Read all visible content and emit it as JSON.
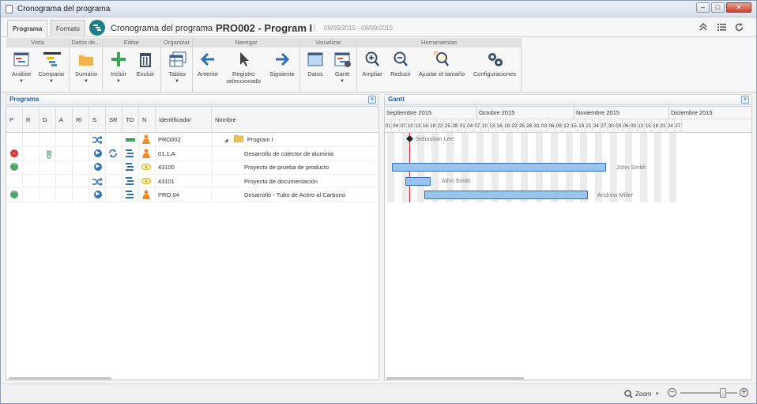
{
  "window": {
    "title": "Cronograma del programa"
  },
  "tabs": [
    {
      "label": "Programa",
      "active": true
    },
    {
      "label": "Formato",
      "active": false
    }
  ],
  "breadcrumb": {
    "section": "Cronograma del programa",
    "separator": "›",
    "record": "PRO002 - Program I",
    "divider": "|",
    "dates": "09/09/2015 - 09/09/2015"
  },
  "ribbon": {
    "groups": [
      {
        "title": "Vista",
        "buttons": [
          {
            "label": "Análise",
            "icon": "analysis-icon"
          },
          {
            "label": "Comparar",
            "icon": "compare-icon"
          }
        ]
      },
      {
        "title": "Datos de...",
        "buttons": [
          {
            "label": "Sumario",
            "icon": "folder-icon"
          }
        ]
      },
      {
        "title": "Editar",
        "buttons": [
          {
            "label": "Incluir",
            "icon": "plus-icon"
          },
          {
            "label": "Excluir",
            "icon": "trash-icon"
          }
        ]
      },
      {
        "title": "Organizar",
        "buttons": [
          {
            "label": "Tablas",
            "icon": "tables-icon"
          }
        ]
      },
      {
        "title": "Navegar",
        "buttons": [
          {
            "label": "Anterior",
            "icon": "arrow-left-icon"
          },
          {
            "label": "Registro seleccionado",
            "icon": "cursor-icon"
          },
          {
            "label": "Siguiente",
            "icon": "arrow-right-icon"
          }
        ]
      },
      {
        "title": "Visualizar",
        "buttons": [
          {
            "label": "Datos",
            "icon": "data-window-icon"
          },
          {
            "label": "Gantt",
            "icon": "gantt-icon"
          }
        ]
      },
      {
        "title": "Herramientas",
        "buttons": [
          {
            "label": "Ampliar",
            "icon": "zoom-in-icon"
          },
          {
            "label": "Reducir",
            "icon": "zoom-out-icon"
          },
          {
            "label": "Ajustar el tamaño",
            "icon": "fit-size-icon"
          },
          {
            "label": "Configuraciones",
            "icon": "gears-icon"
          }
        ]
      }
    ]
  },
  "program_panel": {
    "title": "Programa",
    "collapse": "«"
  },
  "gantt_panel": {
    "title": "Gantt",
    "expand": "»"
  },
  "columns": [
    "P",
    "R",
    "D",
    "A",
    "RI",
    "S",
    "SR",
    "TO",
    "N",
    "Identificador",
    "Nombre"
  ],
  "rows": [
    {
      "id": "PRO002",
      "name": "Program I",
      "tree": "◢",
      "p": "",
      "attach": false,
      "s": "shuffle-icon",
      "sr": "",
      "to": "green",
      "n": "person",
      "is_parent": true
    },
    {
      "id": "01.1.A",
      "name": "Desarrollo de colector de aluminio",
      "p": "down",
      "attach": true,
      "s": "play-icon",
      "sr": "refresh-icon",
      "to": "blue",
      "n": "person"
    },
    {
      "id": "43100",
      "name": "Proyecto de prueba de producto",
      "p": "up",
      "attach": false,
      "s": "play-icon",
      "sr": "",
      "to": "blue",
      "n": "eye"
    },
    {
      "id": "43101",
      "name": "Proyecto de documentación",
      "p": "",
      "attach": false,
      "s": "shuffle-icon",
      "sr": "",
      "to": "blue",
      "n": "eye"
    },
    {
      "id": "PRO.04",
      "name": "Desarrollo - Tubo de Acero al Carbono",
      "p": "up",
      "attach": false,
      "s": "play-icon",
      "sr": "",
      "to": "blue",
      "n": "person"
    }
  ],
  "gantt": {
    "months": [
      "Septiembre 2015",
      "Octubre 2015",
      "Noviembre 2015",
      "Diciembre 2015"
    ],
    "days": [
      "01",
      "04",
      "07",
      "10",
      "13",
      "16",
      "19",
      "22",
      "25",
      "28",
      "01",
      "04",
      "07",
      "10",
      "13",
      "16",
      "19",
      "22",
      "25",
      "28",
      "31",
      "03",
      "06",
      "09",
      "12",
      "15",
      "18",
      "21",
      "24",
      "27",
      "30",
      "03",
      "06",
      "09",
      "12",
      "15",
      "18",
      "21",
      "24",
      "27"
    ],
    "labels": {
      "milestone": "Sebastian Lee",
      "bar1": "John Smith",
      "bar2": "John Smith",
      "bar3": "Andrew Miller"
    }
  },
  "statusbar": {
    "zoom_label": "Zoom",
    "zoom_caret": "▾",
    "minus": "−",
    "plus": "+"
  },
  "colors": {
    "accent": "#1f5fa5",
    "bar": "#9ac4f0",
    "today": "#e0252a",
    "teal": "#1e7e84",
    "green": "#4aa564",
    "red": "#d9353b",
    "orange": "#f08a24",
    "yellow": "#e8b400"
  }
}
